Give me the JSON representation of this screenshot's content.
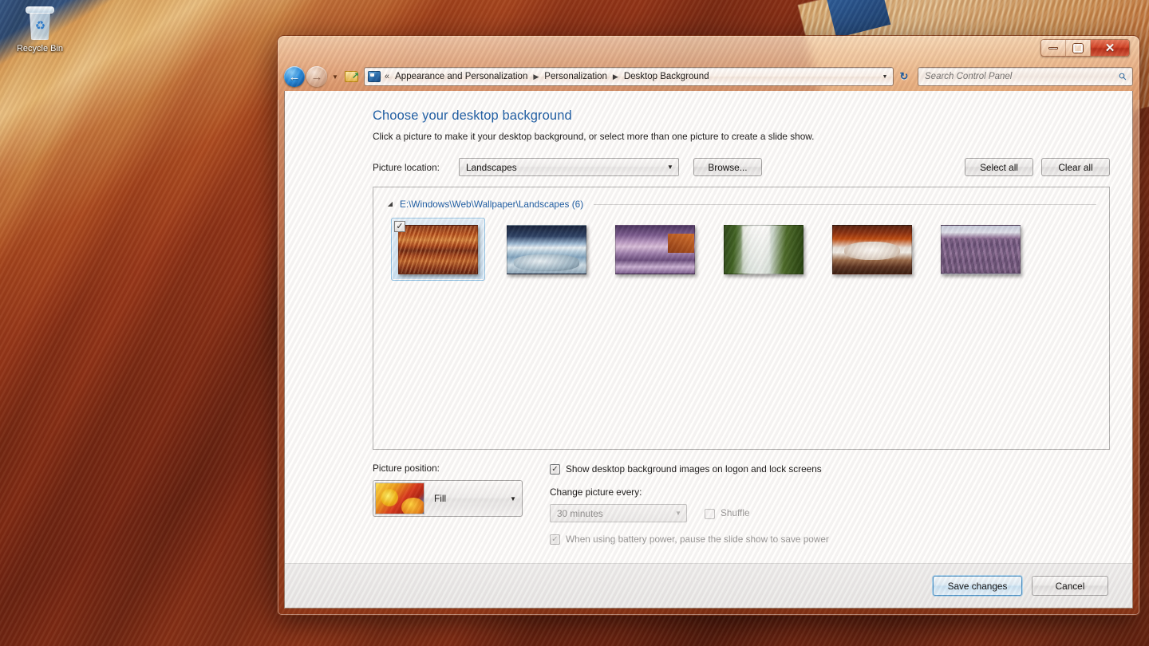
{
  "desktop": {
    "icons": [
      {
        "name": "recycle-bin",
        "label": "Recycle Bin"
      }
    ]
  },
  "window": {
    "caption": {
      "minimize_glyph": "",
      "maximize_glyph": "",
      "close_glyph": "✕"
    },
    "nav": {
      "back_glyph": "←",
      "forward_glyph": "→",
      "recent_glyph": "▼",
      "refresh_glyph": "↻"
    },
    "address": {
      "overflow_glyph": "«",
      "separator_glyph": "▶",
      "dropdown_glyph": "▼",
      "crumbs": [
        "Appearance and Personalization",
        "Personalization",
        "Desktop Background"
      ]
    },
    "search": {
      "value": "",
      "placeholder": "Search Control Panel",
      "icon_glyph": "⚲"
    }
  },
  "page": {
    "title": "Choose your desktop background",
    "subtitle": "Click a picture to make it your desktop background, or select more than one picture to create a slide show.",
    "location_label": "Picture location:",
    "location_value": "Landscapes",
    "browse_label": "Browse...",
    "select_all_label": "Select all",
    "clear_all_label": "Clear all"
  },
  "gallery": {
    "caret_glyph": "◢",
    "path": "E:\\Windows\\Web\\Wallpaper\\Landscapes (6)",
    "count": 6,
    "check_glyph": "✓",
    "thumbnails": [
      {
        "name": "wallpaper-canyon-reflection",
        "selected": true,
        "art": "wp1"
      },
      {
        "name": "wallpaper-lake-sunrise",
        "selected": false,
        "art": "wp2"
      },
      {
        "name": "wallpaper-purple-shore",
        "selected": false,
        "art": "wp3"
      },
      {
        "name": "wallpaper-waterfall",
        "selected": false,
        "art": "wp4"
      },
      {
        "name": "wallpaper-red-cave",
        "selected": false,
        "art": "wp5"
      },
      {
        "name": "wallpaper-lavender-field",
        "selected": false,
        "art": "wp6"
      }
    ]
  },
  "options": {
    "position_label": "Picture position:",
    "position_value": "Fill",
    "position_arrow_glyph": "▼",
    "show_on_logon_label": "Show desktop background images on logon and lock screens",
    "show_on_logon_checked": true,
    "change_every_label": "Change picture every:",
    "interval_value": "30 minutes",
    "interval_enabled": false,
    "shuffle_label": "Shuffle",
    "shuffle_checked": false,
    "shuffle_enabled": false,
    "battery_label": "When using battery power, pause the slide show to save power",
    "battery_checked": true,
    "battery_enabled": false,
    "check_glyph": "✓"
  },
  "footer": {
    "save_label": "Save changes",
    "cancel_label": "Cancel"
  }
}
